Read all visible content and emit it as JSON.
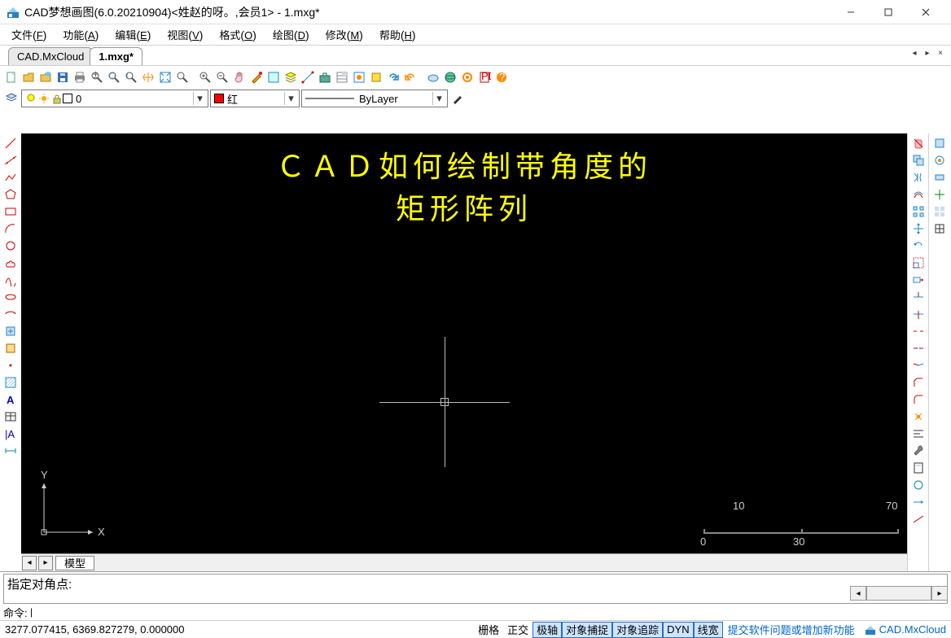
{
  "title": "CAD梦想画图(6.0.20210904)<姓赵的呀。,会员1> - 1.mxg*",
  "menu": [
    {
      "label": "文件",
      "u": "F"
    },
    {
      "label": "功能",
      "u": "A"
    },
    {
      "label": "编辑",
      "u": "E"
    },
    {
      "label": "视图",
      "u": "V"
    },
    {
      "label": "格式",
      "u": "O"
    },
    {
      "label": "绘图",
      "u": "D"
    },
    {
      "label": "修改",
      "u": "M"
    },
    {
      "label": "帮助",
      "u": "H"
    }
  ],
  "tabs": [
    {
      "label": "CAD.MxCloud",
      "active": false
    },
    {
      "label": "1.mxg*",
      "active": true
    }
  ],
  "layer_combo": "0",
  "color_combo": "红",
  "linetype_combo": "ByLayer",
  "overlay": {
    "line1": "ＣＡＤ如何绘制带角度的",
    "line2": "矩形阵列"
  },
  "ucs": {
    "x": "X",
    "y": "Y"
  },
  "scale": {
    "v10": "10",
    "v70": "70",
    "v0": "0",
    "v30": "30"
  },
  "model_tab": "模型",
  "cmd_history": "指定对角点:",
  "cmd_prompt": "命令:",
  "coords": "3277.077415, 6369.827279, 0.000000",
  "status": {
    "grid": "栅格",
    "ortho": "正交",
    "polar": "极轴",
    "osnap": "对象捕捉",
    "otrack": "对象追踪",
    "dyn": "DYN",
    "lwt": "线宽"
  },
  "submit_link": "提交软件问题或增加新功能",
  "cloud_label": "CAD.MxCloud"
}
